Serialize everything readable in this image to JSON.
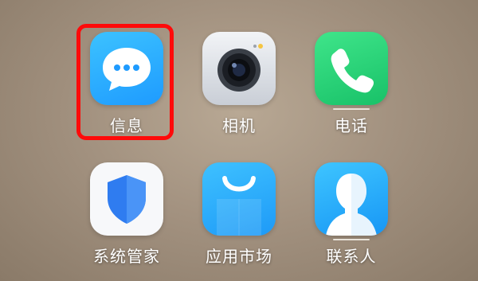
{
  "apps": [
    {
      "label": "信息",
      "icon": "message-bubble-icon",
      "color": "#1e9bff"
    },
    {
      "label": "相机",
      "icon": "camera-icon",
      "color": "#c9ced6"
    },
    {
      "label": "电话",
      "icon": "phone-icon",
      "color": "#18c168"
    },
    {
      "label": "系统管家",
      "icon": "shield-icon",
      "color": "#2f7cf0"
    },
    {
      "label": "应用市场",
      "icon": "shopping-bag-icon",
      "color": "#1e9af7"
    },
    {
      "label": "联系人",
      "icon": "contact-person-icon",
      "color": "#1796f5"
    }
  ],
  "highlight": {
    "target": "信息",
    "color": "#ff0a0a"
  }
}
